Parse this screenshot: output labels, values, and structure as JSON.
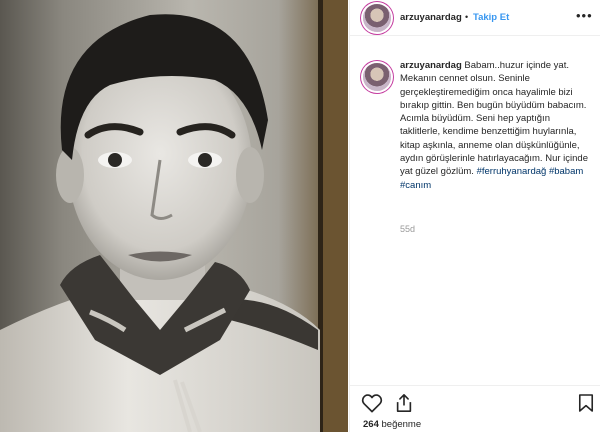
{
  "header": {
    "username": "arzuyanardag",
    "separator": "•",
    "follow_label": "Takip Et",
    "more_icon": "more-horizontal-icon"
  },
  "caption": {
    "username": "arzuyanardag",
    "text": "Babam..huzur içinde yat. Mekanın cennet olsun. Seninle gerçekleştiremediğim onca hayalimle bizi bırakıp gittin. Ben bugün büyüdüm babacım. Acımla büyüdüm. Seni hep yaptığın taklitlerle, kendime benzettiğim huylarınla, kitap aşkınla, anneme olan düşkünlüğünle, aydın görüşlerinle hatırlayacağım. Nur içinde yat güzel gözlüm.",
    "hashtags": [
      "#ferruhyanardağ",
      "#babam",
      "#canım"
    ],
    "age": "55d"
  },
  "actions": {
    "like_icon": "heart-icon",
    "share_icon": "share-icon",
    "save_icon": "bookmark-icon",
    "likes_count": "264",
    "likes_label": "beğenme"
  },
  "colors": {
    "follow": "#3897f0",
    "hashtag": "#003569",
    "muted": "#999999",
    "text": "#262626"
  }
}
